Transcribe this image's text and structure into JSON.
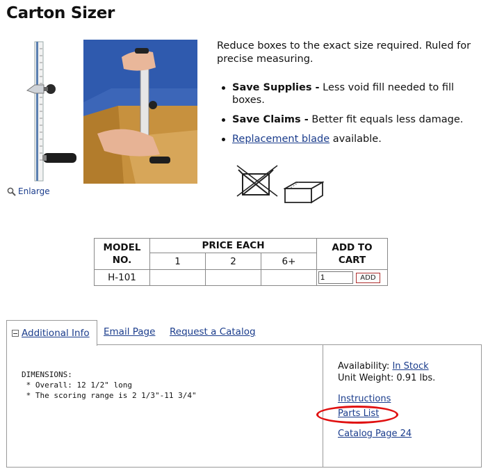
{
  "product": {
    "title": "Carton Sizer",
    "enlarge_label": "Enlarge",
    "description": "Reduce boxes to the exact size required. Ruled for precise measuring.",
    "features": [
      {
        "bold": "Save Supplies -",
        "text": " Less void fill needed to fill boxes."
      },
      {
        "bold": "Save Claims -",
        "text": " Better fit equals less damage."
      }
    ],
    "replacement_link": "Replacement blade",
    "replacement_suffix": " available."
  },
  "price_table": {
    "model_header": "MODEL NO.",
    "price_header": "PRICE EACH",
    "cart_header": "ADD TO CART",
    "qty_headers": [
      "1",
      "2",
      "6+"
    ],
    "row": {
      "model": "H-101",
      "prices": [
        "",
        "",
        ""
      ],
      "qty_value": "1",
      "add_label": "ADD"
    }
  },
  "tabs": {
    "active": "Additional Info",
    "email": "Email Page",
    "catalog": "Request a Catalog"
  },
  "info": {
    "dimensions_text": "DIMENSIONS:\n * Overall: 12 1/2\" long\n * The scoring range is 2 1/3\"-11 3/4\"",
    "availability_label": "Availability: ",
    "availability_value": "In Stock",
    "weight_text": "Unit Weight: 0.91 lbs.",
    "links": {
      "instructions": "Instructions",
      "parts_list": "Parts List",
      "catalog_page": "Catalog Page 24"
    }
  },
  "colors": {
    "link": "#1a3c8c",
    "highlight": "#e01010"
  }
}
